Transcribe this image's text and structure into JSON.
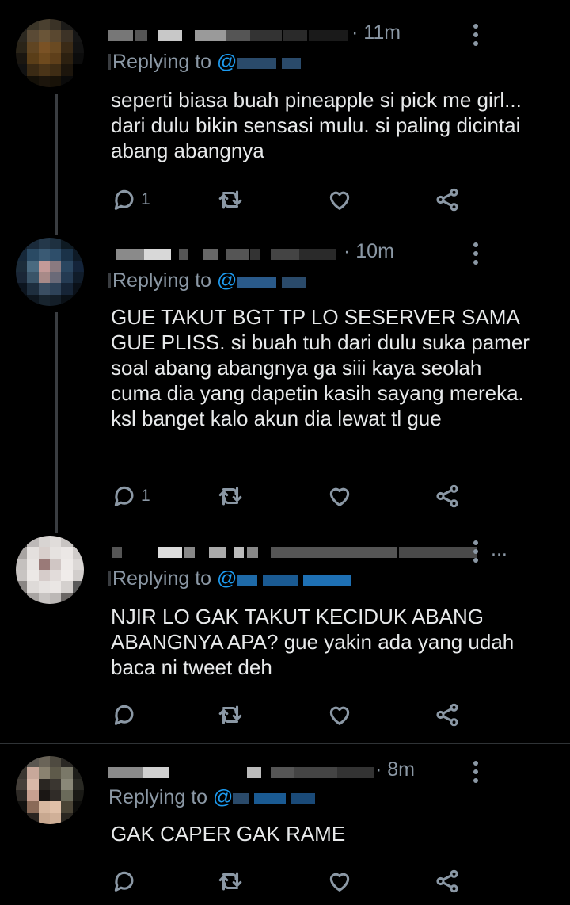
{
  "tweets": [
    {
      "time": "· 11m",
      "replying_prefix": "Replying to",
      "mention_at": "@",
      "body": "seperti biasa buah pineapple si pick me girl... dari dulu bikin sensasi mulu. si paling dicintai abang abangnya",
      "reply_count": "1",
      "avatar_colors": [
        "#1b1b1b",
        "#3b3528",
        "#4a4030",
        "#3a3226",
        "#1b1a18",
        "#101010",
        "#2c2820",
        "#5a4a35",
        "#6a5538",
        "#5a4830",
        "#3c3226",
        "#151515",
        "#2a2418",
        "#604522",
        "#7a5225",
        "#6a4a22",
        "#3a2a16",
        "#121212",
        "#1a1610",
        "#5a3e18",
        "#6e4a1e",
        "#5e3f1a",
        "#2c2010",
        "#0c0c0c",
        "#111",
        "#3a2a14",
        "#4a3418",
        "#3e2c14",
        "#1c150c",
        "#000",
        "#000",
        "#141008",
        "#1c150c",
        "#181208",
        "#0a0a0a",
        "#000"
      ]
    },
    {
      "time": "· 10m",
      "replying_prefix": "Replying to",
      "mention_at": "@",
      "body": "GUE TAKUT BGT TP LO SESERVER SAMA GUE PLISS. si buah tuh dari dulu suka pamer soal abang abangnya ga siii kaya seolah cuma dia yang dapetin kasih sayang mereka. ksl banget kalo akun dia lewat tl gue",
      "reply_count": "1",
      "avatar_colors": [
        "#0e1a24",
        "#1a2a3a",
        "#24384a",
        "#1e3040",
        "#0e1a22",
        "#0a0f14",
        "#16283a",
        "#2a4a64",
        "#3a5a74",
        "#2e4e6a",
        "#1a3248",
        "#0e1a26",
        "#1c2c3a",
        "#4a6a80",
        "#c49a98",
        "#8a7a80",
        "#2a4660",
        "#14243a",
        "#1a2636",
        "#3a5468",
        "#a88a88",
        "#6a6a78",
        "#243a52",
        "#101c2a",
        "#0c141e",
        "#1e2e3e",
        "#3a4e62",
        "#2e4258",
        "#162436",
        "#0a1018",
        "#05080c",
        "#0e161e",
        "#18242e",
        "#141e28",
        "#0a1016",
        "#05080c"
      ]
    },
    {
      "time": "...",
      "replying_prefix": "Replying to",
      "mention_at": "@",
      "body": "NJIR LO GAK TAKUT KECIDUK ABANG ABANGNYA APA? gue yakin ada yang udah baca ni tweet deh",
      "reply_count": "",
      "avatar_colors": [
        "#2a2a2a",
        "#bdb9b8",
        "#d8d4d2",
        "#e0dcda",
        "#c8c4c2",
        "#3a3a3a",
        "#a8a4a2",
        "#e4e0de",
        "#d8cfcc",
        "#e6e2e0",
        "#ebe7e5",
        "#cfcbc9",
        "#c4c0be",
        "#e8e4e2",
        "#9a7a78",
        "#d0c6c4",
        "#eeeae8",
        "#dcd8d6",
        "#c8c4c2",
        "#ece8e6",
        "#d6ccca",
        "#e2dcda",
        "#f0ecea",
        "#d2cecc",
        "#8a8684",
        "#dedad8",
        "#e6e2e0",
        "#eae6e4",
        "#d4d0ce",
        "#5a5a5a",
        "#1a1a1a",
        "#a8a4a2",
        "#c8c4c2",
        "#bcb8b6",
        "#6a6664",
        "#101010"
      ]
    },
    {
      "time": "· 8m",
      "replying_prefix": "Replying to",
      "mention_at": "@",
      "body": "GAK CAPER GAK RAME",
      "reply_count": "",
      "avatar_colors": [
        "#1a1a1a",
        "#5a5650",
        "#6a6458",
        "#4e4a40",
        "#2a2824",
        "#0c0c0c",
        "#3a3630",
        "#c8a89a",
        "#8a8270",
        "#5e5a4a",
        "#7a7868",
        "#1e1e1a",
        "#46403a",
        "#d8b8a8",
        "#2a2622",
        "#3a3630",
        "#8a8878",
        "#2a2a24",
        "#2e2a26",
        "#c8a090",
        "#1a1614",
        "#302c28",
        "#6a6a5a",
        "#1a1a16",
        "#121210",
        "#8a6a58",
        "#d8b8a0",
        "#e0c0a8",
        "#4a4436",
        "#0c0c0a",
        "#000",
        "#2a2420",
        "#c8a890",
        "#d0b098",
        "#2a2620",
        "#000"
      ]
    }
  ],
  "colors": {
    "background": "#000000",
    "text": "#e7e9ea",
    "secondary": "#8b98a5",
    "mention": "#1d9bf0",
    "thread_line": "#3a3d41",
    "divider": "#2f3336"
  },
  "icons": [
    "reply-icon",
    "retweet-icon",
    "like-icon",
    "share-icon",
    "more-icon"
  ]
}
